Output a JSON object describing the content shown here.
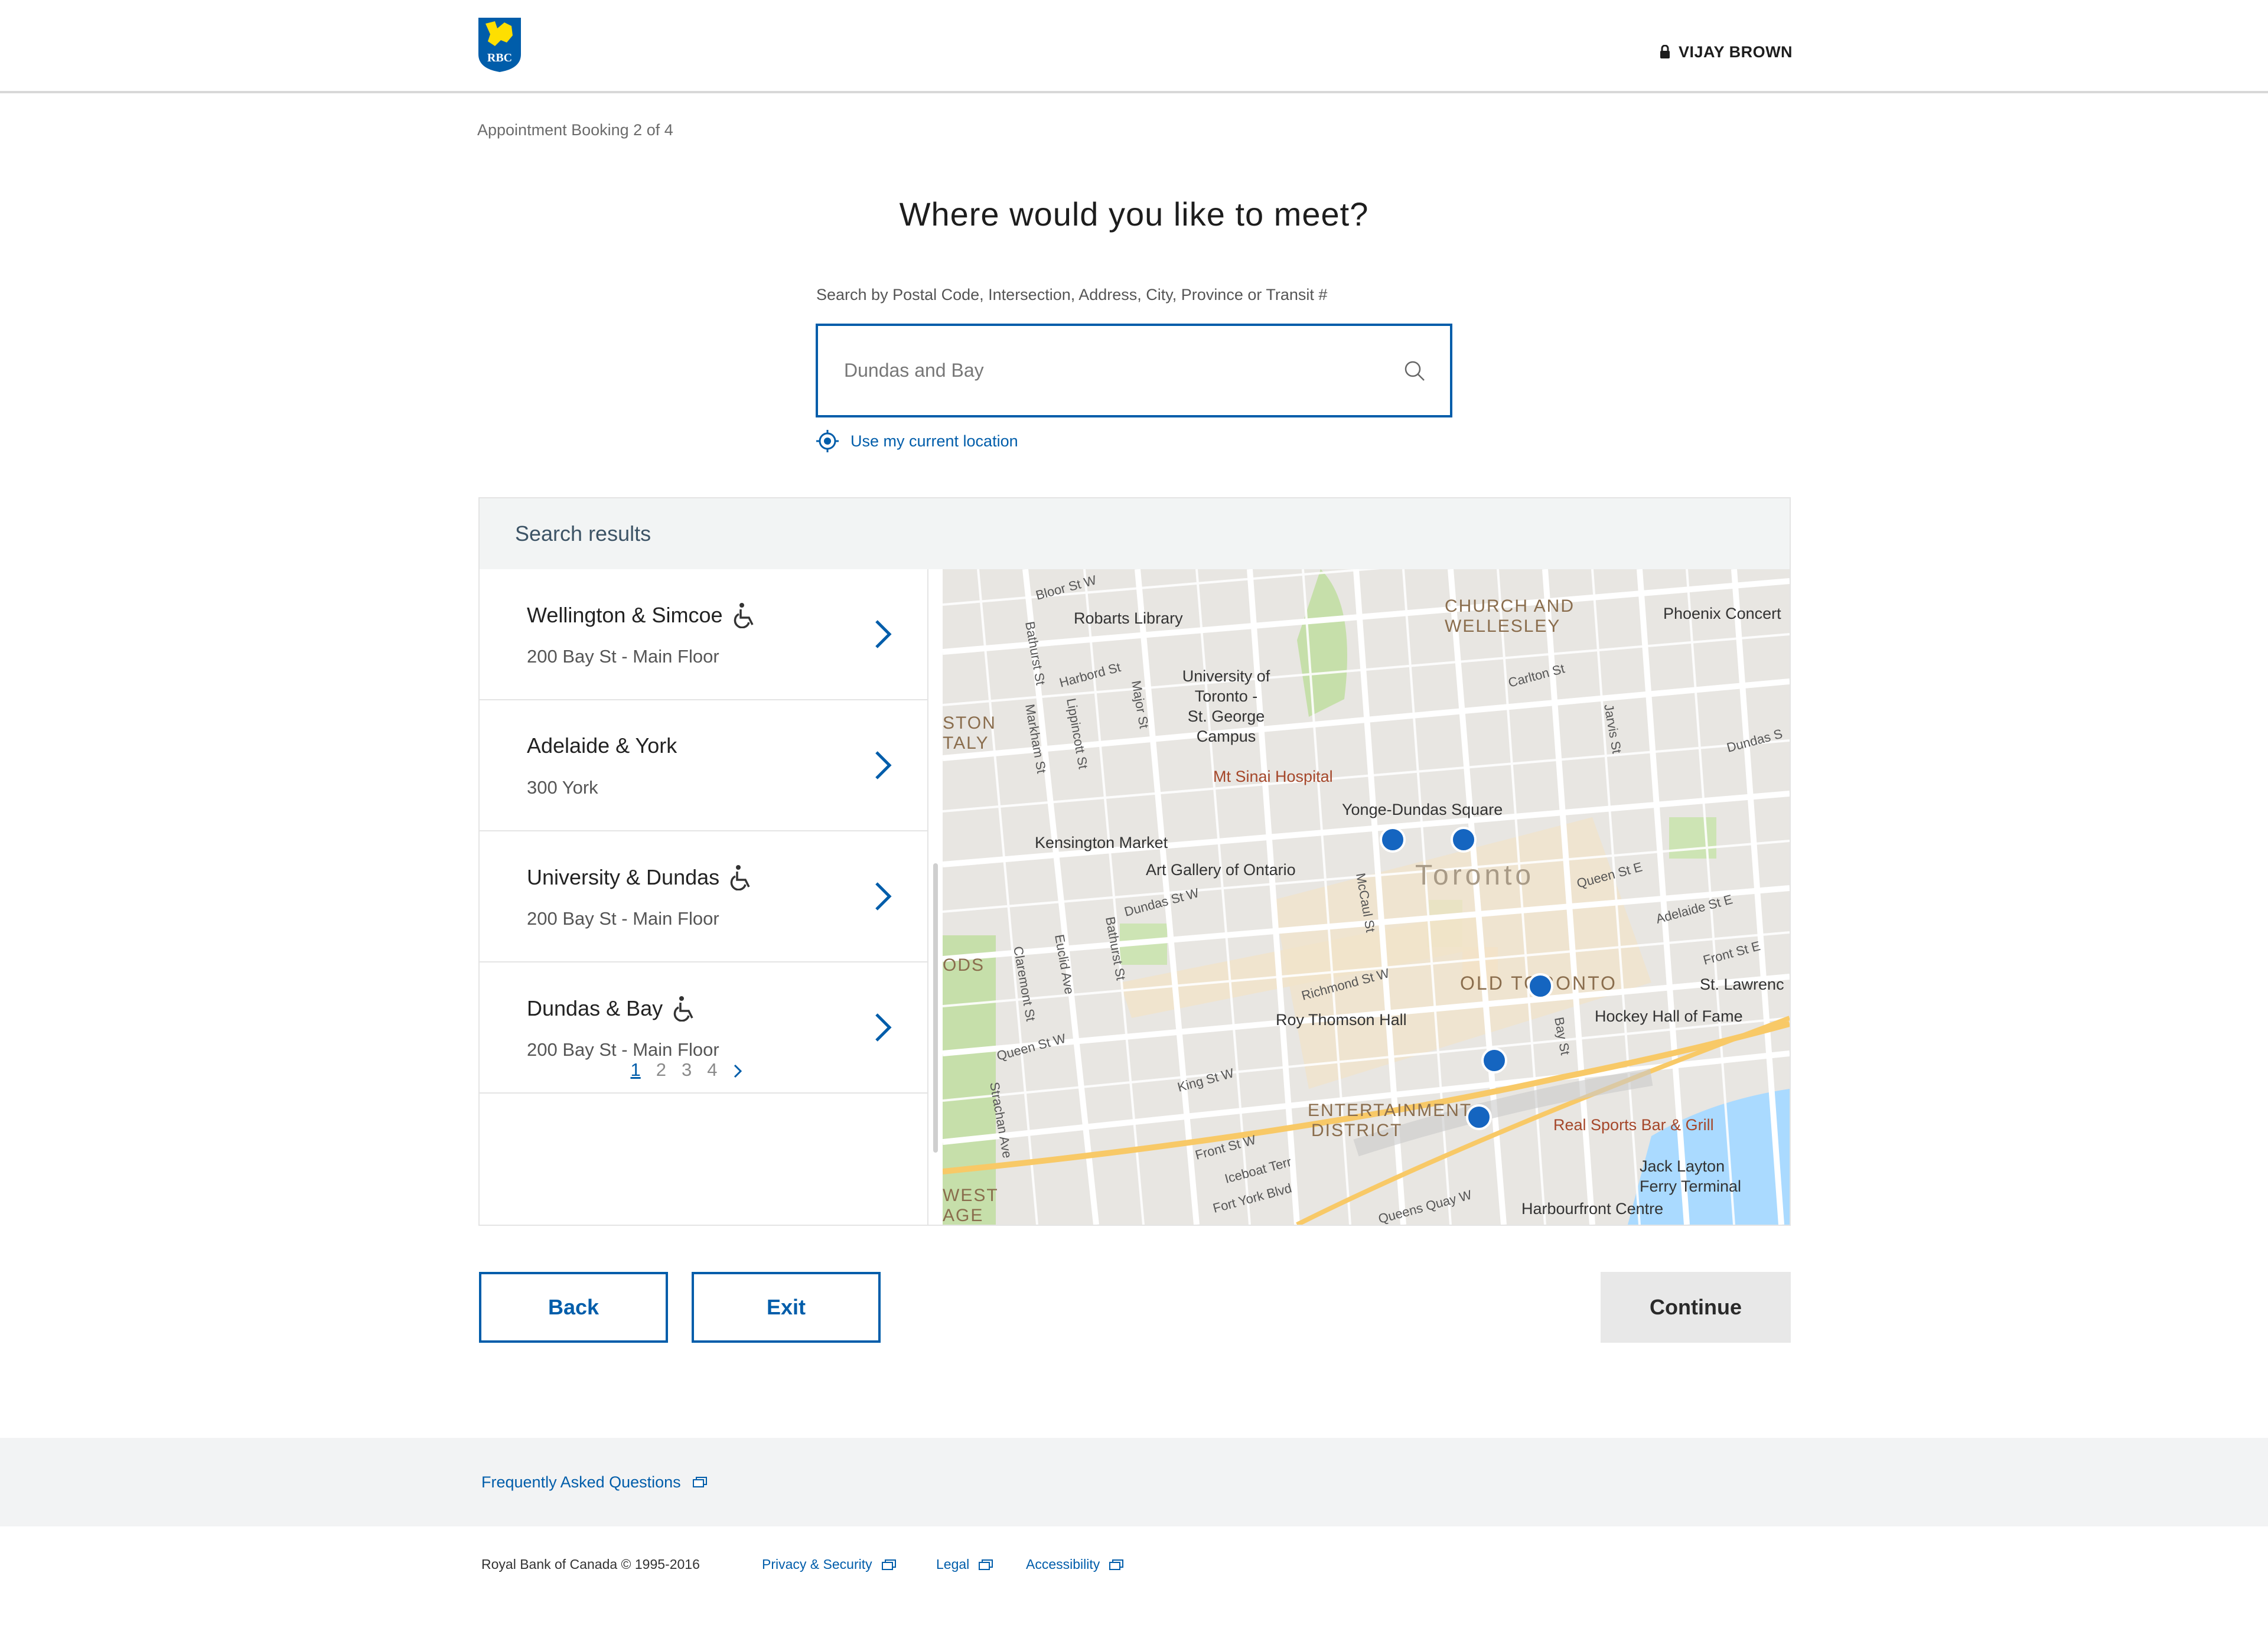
{
  "header": {
    "logo_text": "RBC",
    "user_name": "VIJAY BROWN"
  },
  "step": "Appointment Booking 2 of 4",
  "title": "Where would you like to meet?",
  "search": {
    "label": "Search by Postal Code, Intersection, Address, City, Province or Transit #",
    "value": "Dundas and Bay",
    "current_location": "Use my current location"
  },
  "results": {
    "title": "Search results",
    "items": [
      {
        "name": "Wellington & Simcoe",
        "address": "200 Bay St - Main Floor",
        "accessible": true
      },
      {
        "name": "Adelaide & York",
        "address": "300 York",
        "accessible": false
      },
      {
        "name": "University & Dundas",
        "address": "200 Bay St - Main Floor",
        "accessible": true
      },
      {
        "name": "Dundas & Bay",
        "address": "200 Bay St - Main Floor",
        "accessible": true
      }
    ],
    "pages": [
      "1",
      "2",
      "3",
      "4"
    ],
    "current_page": "1"
  },
  "map": {
    "labels": {
      "bloor": "Bloor St W",
      "robarts": "Robarts Library",
      "church": "CHURCH AND",
      "wellesley": "WELLESLEY",
      "phoenix": "Phoenix Concert",
      "harbord": "Harbord St",
      "uoft1": "University of",
      "uoft2": "Toronto -",
      "uoft3": "St. George",
      "uoft4": "Campus",
      "carlton": "Carlton St",
      "bathurst": "Bathurst St",
      "markham": "Markham St",
      "lippincott": "Lippincott St",
      "major": "Major St",
      "jarvis": "Jarvis St",
      "dundas_e": "Dundas S",
      "ston": "STON",
      "taly": "TALY",
      "sinai": "Mt Sinai Hospital",
      "yonge_dundas": "Yonge-Dundas Square",
      "kensington": "Kensington Market",
      "ago": "Art Gallery of Ontario",
      "toronto": "Toronto",
      "queen_e": "Queen St E",
      "dundas_w": "Dundas St W",
      "mccaul": "McCaul St",
      "adelaide_e": "Adelaide St E",
      "front_e": "Front St E",
      "richmond": "Richmond St W",
      "old_toronto": "OLD TORONTO",
      "st_lawrence": "St. Lawrenc",
      "ods": "ODS",
      "claremont": "Claremont St",
      "euclid": "Euclid Ave",
      "bathurst2": "Bathurst St",
      "roy": "Roy Thomson Hall",
      "bay": "Bay St",
      "hockey": "Hockey Hall of Fame",
      "queen_w": "Queen St W",
      "king": "King St W",
      "strachan": "Strachan Ave",
      "entertainment1": "ENTERTAINMENT",
      "entertainment2": "DISTRICT",
      "realsports": "Real Sports Bar & Grill",
      "front_w": "Front St W",
      "iceboat": "Iceboat Terr",
      "fortyork": "Fort York Blvd",
      "jack1": "Jack Layton",
      "jack2": "Ferry Terminal",
      "west": "WEST",
      "age": "AGE",
      "queens_quay": "Queens Quay W",
      "harbourfront": "Harbourfront Centre"
    }
  },
  "buttons": {
    "back": "Back",
    "exit": "Exit",
    "continue": "Continue"
  },
  "footer": {
    "faq": "Frequently Asked Questions",
    "copyright": "Royal Bank of Canada © 1995-2016",
    "privacy": "Privacy & Security",
    "legal": "Legal",
    "accessibility": "Accessibility"
  },
  "colors": {
    "brand_blue": "#005daa",
    "brand_yellow": "#fedf01",
    "map_pin": "#1565c0"
  }
}
